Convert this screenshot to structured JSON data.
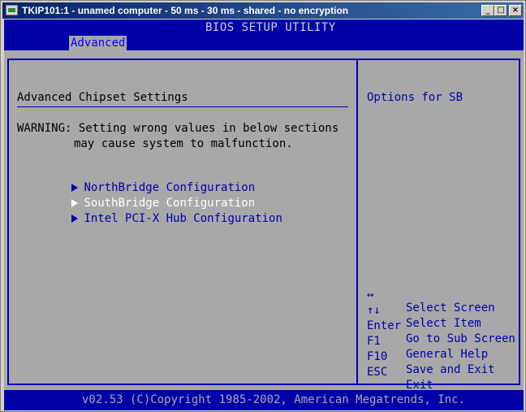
{
  "window": {
    "title": "TKIP101:1 - unamed computer - 50 ms - 30 ms - shared - no encryption",
    "minimize_glyph": "_",
    "maximize_glyph": "□",
    "close_glyph": "×"
  },
  "bios": {
    "title": "BIOS SETUP UTILITY",
    "active_tab": "Advanced",
    "section_title": "Advanced Chipset Settings",
    "warning_line1": "WARNING: Setting wrong values in below sections",
    "warning_line2": "may cause system to malfunction.",
    "menu": [
      {
        "label": "NorthBridge Configuration",
        "selected": false
      },
      {
        "label": "SouthBridge Configuration",
        "selected": true
      },
      {
        "label": "Intel PCI-X Hub Configuration",
        "selected": false
      }
    ],
    "help_title": "Options for SB",
    "keys": [
      {
        "key": "↔",
        "desc": "Select Screen"
      },
      {
        "key": "↑↓",
        "desc": "Select Item"
      },
      {
        "key": "Enter",
        "desc": "Go to Sub Screen"
      },
      {
        "key": "F1",
        "desc": "General Help"
      },
      {
        "key": "F10",
        "desc": "Save and Exit"
      },
      {
        "key": "ESC",
        "desc": "Exit"
      }
    ],
    "footer": "v02.53 (C)Copyright 1985-2002, American Megatrends, Inc."
  },
  "colors": {
    "bios_blue": "#0000a8",
    "bios_gray": "#a8a8a8",
    "selected_text": "#ffffff"
  }
}
